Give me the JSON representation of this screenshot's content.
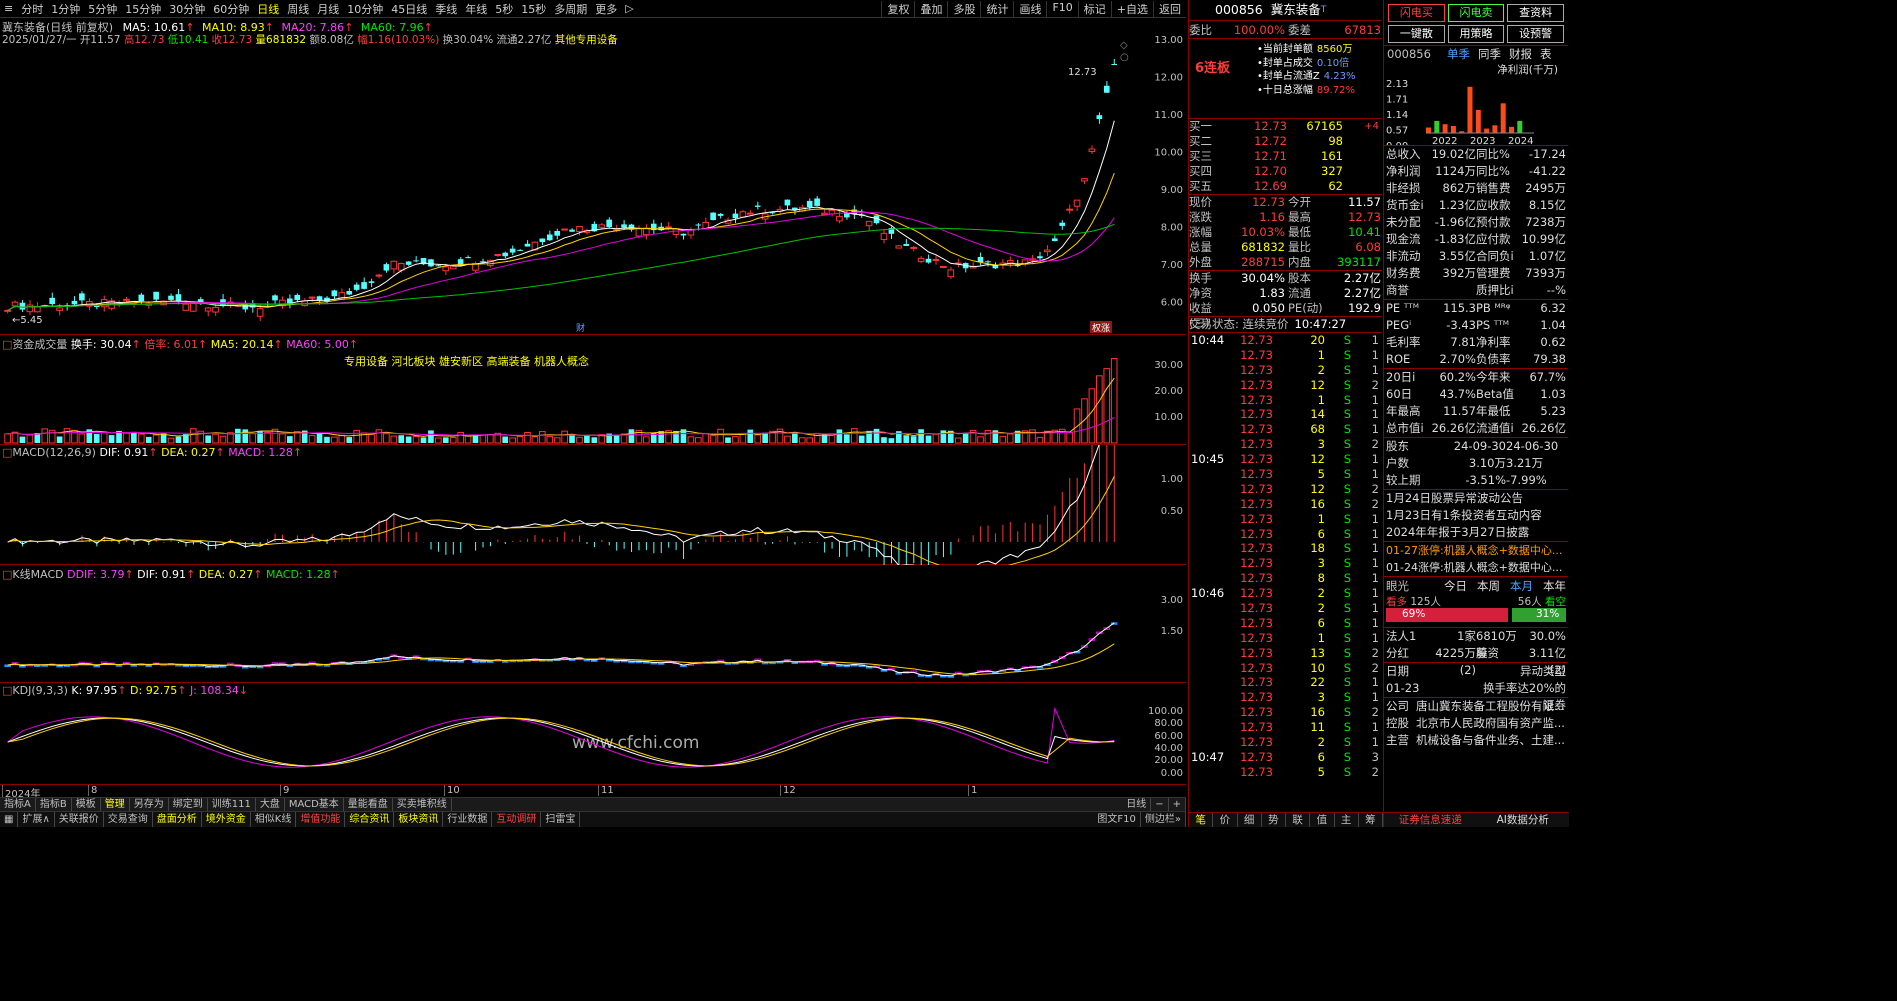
{
  "toolbar": {
    "items": [
      "分时",
      "1分钟",
      "5分钟",
      "15分钟",
      "30分钟",
      "60分钟",
      "日线",
      "周线",
      "月线",
      "10分钟",
      "45日线",
      "季线",
      "年线",
      "5秒",
      "15秒",
      "多周期",
      "更多"
    ],
    "active": "日线",
    "right": [
      "复权",
      "叠加",
      "多股",
      "统计",
      "画线",
      "F10",
      "标记",
      "+自选",
      "返回"
    ]
  },
  "chart": {
    "title": "冀东装备(日线 前复权)",
    "ma5": "MA5: 10.61",
    "ma10": "MA10: 8.93",
    "ma20": "MA20: 7.86",
    "ma60": "MA60: 7.96",
    "line2": {
      "date": "2025/01/27/一",
      "open": "开11.57",
      "high": "高12.73",
      "low": "低10.41",
      "close": "收12.73",
      "vol": "量681832",
      "amt": "额8.08亿",
      "amp": "幅1.16(10.03%)",
      "turn": "换30.04%",
      "float": "流通2.27亿",
      "ind": "其他专用设备"
    },
    "yticks": [
      "13.00",
      "12.00",
      "11.00",
      "10.00",
      "9.00",
      "8.00",
      "7.00",
      "6.00"
    ],
    "hi_label": "12.73",
    "lo_label": "5.45",
    "badge1": "财",
    "badge2": "权涨"
  },
  "vol": {
    "title": "资金成交量",
    "turn": "换手: 30.04",
    "rate": "倍率: 6.01",
    "ma5": "MA5: 20.14",
    "ma60": "MA60: 5.00",
    "concepts": "专用设备 河北板块 雄安新区 高端装备 机器人概念",
    "yticks": [
      "30.00",
      "20.00",
      "10.00"
    ]
  },
  "macd": {
    "title": "MACD(12,26,9)",
    "dif": "DIF: 0.91",
    "dea": "DEA: 0.27",
    "macd": "MACD: 1.28",
    "yticks": [
      "1.00",
      "0.50"
    ]
  },
  "kmacd": {
    "title": "K线MACD",
    "ddif": "DDIF: 3.79",
    "dif": "DIF: 0.91",
    "dea": "DEA: 0.27",
    "macd": "MACD: 1.28",
    "yticks": [
      "3.00",
      "1.50"
    ]
  },
  "kdj": {
    "title": "KDJ(9,3,3)",
    "k": "K: 97.95",
    "d": "D: 92.75",
    "j": "J: 108.34",
    "yticks": [
      "100.00",
      "80.00",
      "60.00",
      "40.00",
      "20.00",
      "0.00"
    ],
    "watermark": "www.cfchi.com"
  },
  "dates": [
    "2024年",
    "8",
    "9",
    "10",
    "11",
    "12",
    "1"
  ],
  "tabs1": [
    "指标A",
    "指标B",
    "模板",
    "管理",
    "另存为",
    "绑定到",
    "训练111",
    "大盘",
    "MACD基本",
    "量能看盘",
    "买卖堆积线"
  ],
  "tabs1_right": "日线",
  "tabs2": [
    "扩展∧",
    "关联报价",
    "交易查询",
    "盘面分析",
    "境外资金",
    "相似K线",
    "增值功能",
    "综合资讯",
    "板块资讯",
    "行业数据",
    "互动调研",
    "扫雷宝"
  ],
  "tabs2_right": [
    "图文F10",
    "侧边栏»"
  ],
  "quote": {
    "code": "000856",
    "name": "冀东装备",
    "weibi_l": "委比",
    "weibi": "100.00%",
    "weicha_l": "委差",
    "weicha": "67813",
    "lianban": "6连板",
    "seal": [
      [
        "当前封单额",
        "8560万"
      ],
      [
        "封单占成交",
        "0.10倍"
      ],
      [
        "封单占流通Z",
        "4.23%"
      ],
      [
        "十日总涨幅",
        "89.72%"
      ]
    ],
    "buy": [
      [
        "买一",
        "12.73",
        "67165",
        "+4"
      ],
      [
        "买二",
        "12.72",
        "98",
        ""
      ],
      [
        "买三",
        "12.71",
        "161",
        ""
      ],
      [
        "买四",
        "12.70",
        "327",
        ""
      ],
      [
        "买五",
        "12.69",
        "62",
        ""
      ]
    ],
    "stats": [
      [
        "现价",
        "12.73",
        "今开",
        "11.57"
      ],
      [
        "涨跌",
        "1.16",
        "最高",
        "12.73"
      ],
      [
        "涨幅",
        "10.03%",
        "最低",
        "10.41"
      ],
      [
        "总量",
        "681832",
        "量比",
        "6.08"
      ],
      [
        "外盘",
        "288715",
        "内盘",
        "393117"
      ]
    ],
    "stats2": [
      [
        "换手",
        "30.04%",
        "股本",
        "2.27亿"
      ],
      [
        "净资",
        "1.83",
        "流通",
        "2.27亿"
      ],
      [
        "收益(三)",
        "0.050",
        "PE(动)",
        "192.9"
      ]
    ],
    "status": "交易状态: 连续竞价",
    "time": "10:47:27",
    "ticks": [
      [
        "10:44",
        "12.73",
        "20",
        "S",
        "1"
      ],
      [
        "",
        "12.73",
        "1",
        "S",
        "1"
      ],
      [
        "",
        "12.73",
        "2",
        "S",
        "1"
      ],
      [
        "",
        "12.73",
        "12",
        "S",
        "2"
      ],
      [
        "",
        "12.73",
        "1",
        "S",
        "1"
      ],
      [
        "",
        "12.73",
        "14",
        "S",
        "1"
      ],
      [
        "",
        "12.73",
        "68",
        "S",
        "1"
      ],
      [
        "",
        "12.73",
        "3",
        "S",
        "2"
      ],
      [
        "10:45",
        "12.73",
        "12",
        "S",
        "1"
      ],
      [
        "",
        "12.73",
        "5",
        "S",
        "1"
      ],
      [
        "",
        "12.73",
        "12",
        "S",
        "2"
      ],
      [
        "",
        "12.73",
        "16",
        "S",
        "2"
      ],
      [
        "",
        "12.73",
        "1",
        "S",
        "1"
      ],
      [
        "",
        "12.73",
        "6",
        "S",
        "1"
      ],
      [
        "",
        "12.73",
        "18",
        "S",
        "1"
      ],
      [
        "",
        "12.73",
        "3",
        "S",
        "1"
      ],
      [
        "",
        "12.73",
        "8",
        "S",
        "1"
      ],
      [
        "10:46",
        "12.73",
        "2",
        "S",
        "1"
      ],
      [
        "",
        "12.73",
        "2",
        "S",
        "1"
      ],
      [
        "",
        "12.73",
        "6",
        "S",
        "1"
      ],
      [
        "",
        "12.73",
        "1",
        "S",
        "1"
      ],
      [
        "",
        "12.73",
        "13",
        "S",
        "2"
      ],
      [
        "",
        "12.73",
        "10",
        "S",
        "2"
      ],
      [
        "",
        "12.73",
        "22",
        "S",
        "1"
      ],
      [
        "",
        "12.73",
        "3",
        "S",
        "1"
      ],
      [
        "",
        "12.73",
        "16",
        "S",
        "2"
      ],
      [
        "",
        "12.73",
        "11",
        "S",
        "1"
      ],
      [
        "",
        "12.73",
        "2",
        "S",
        "1"
      ],
      [
        "10:47",
        "12.73",
        "6",
        "S",
        "3"
      ],
      [
        "",
        "12.73",
        "5",
        "S",
        "2"
      ]
    ],
    "bottom_tabs": [
      "笔",
      "价",
      "细",
      "势",
      "联",
      "值",
      "主",
      "筹"
    ]
  },
  "fin": {
    "btns": [
      "闪电买",
      "闪电卖",
      "查资料",
      "一键散",
      "用策略",
      "设预警"
    ],
    "code": "000856",
    "tabs": [
      "单季",
      "同季",
      "财报",
      "表"
    ],
    "chart_title": "净利润(千万)",
    "chart_data": {
      "type": "bar",
      "categories": [
        "2022",
        "2023",
        "2024"
      ],
      "yticks": [
        "2.13",
        "1.71",
        "1.14",
        "0.57",
        "0.00"
      ],
      "series": [
        {
          "name": "净利润",
          "values": [
            0.25,
            0.55,
            0.4,
            0.32,
            0.08,
            2.1,
            1.05,
            0.2,
            0.35,
            1.35,
            0.28,
            0.55
          ]
        }
      ],
      "green": [
        1,
        11
      ]
    },
    "rows1": [
      [
        "总收入",
        "19.02亿",
        "同比%",
        "-17.24"
      ],
      [
        "净利润",
        "1124万",
        "同比%",
        "-41.22"
      ],
      [
        "非经损",
        "862万",
        "销售费",
        "2495万"
      ],
      [
        "货币金i",
        "1.23亿",
        "应收款",
        "8.15亿"
      ],
      [
        "未分配",
        "-1.96亿",
        "预付款",
        "7238万"
      ],
      [
        "现金流",
        "-1.83亿",
        "应付款",
        "10.99亿"
      ],
      [
        "非流动",
        "3.55亿",
        "合同负i",
        "1.07亿"
      ],
      [
        "财务费",
        "392万",
        "管理费",
        "7393万"
      ],
      [
        "商誉",
        "",
        "质押比i",
        "--%"
      ]
    ],
    "rows2": [
      [
        "PE ᵀᵀᴹ",
        "115.3",
        "PB ᴹᴿᵠ",
        "6.32"
      ],
      [
        "PEGⁱ",
        "-3.43",
        "PS ᵀᵀᴹ",
        "1.04"
      ],
      [
        "毛利率",
        "7.81",
        "净利率",
        "0.62"
      ],
      [
        "ROE",
        "2.70%",
        "负债率",
        "79.38"
      ]
    ],
    "rows3": [
      [
        "20日i",
        "60.2%",
        "今年来",
        "67.7%"
      ],
      [
        "60日",
        "43.7%",
        "Beta值",
        "1.03"
      ],
      [
        "年最高",
        "11.57",
        "年最低",
        "5.23"
      ],
      [
        "总市值i",
        "26.26亿",
        "流通值i",
        "26.26亿"
      ]
    ],
    "rows4": [
      [
        "股东",
        "24-09-30",
        "24-06-30"
      ],
      [
        "户数",
        "3.10万",
        "3.21万"
      ],
      [
        "较上期",
        "-3.51%",
        "-7.99%"
      ]
    ],
    "news": [
      "1月24日股票异常波动公告",
      "1月23日有1条投资者互动内容",
      "2024年年报于3月27日披露"
    ],
    "news2": [
      "01-27涨停:机器人概念+数据中心...",
      "01-24涨停:机器人概念+数据中心..."
    ],
    "eye": {
      "title": "眼光",
      "tabs": [
        "今日",
        "本周",
        "本月",
        "本年"
      ],
      "bull": "看多",
      "bulln": "125人",
      "bear": "看空",
      "bearn": "56人",
      "pbull": "69%",
      "pbear": "31%"
    },
    "rows5": [
      [
        "法人1",
        "1家",
        "6810万股",
        "30.0%"
      ],
      [
        "分红",
        "4225万(2)",
        "募资",
        "3.11亿(2)"
      ]
    ],
    "rows6": [
      [
        "日期",
        "异动类型"
      ],
      [
        "01-23",
        "换手率达20%的证券"
      ]
    ],
    "company": [
      [
        "公司",
        "唐山冀东装备工程股份有限..."
      ],
      [
        "控股",
        "北京市人民政府国有资产监..."
      ],
      [
        "主营",
        "机械设备与备件业务、土建..."
      ]
    ],
    "bottom": [
      "证券信息速递",
      "AI数据分析"
    ]
  }
}
